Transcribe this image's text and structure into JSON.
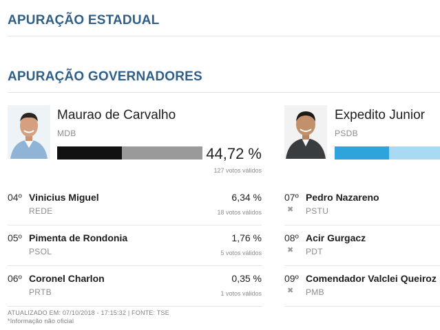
{
  "sections": {
    "state": "APURAÇÃO ESTADUAL",
    "governors": "APURAÇÃO GOVERNADORES"
  },
  "leaders": [
    {
      "name": "Maurao de Carvalho",
      "party": "MDB",
      "percent": "44,72 %",
      "votes": "127 votos válidos",
      "bar_fraction": 0.4472,
      "bar_color": "#111111",
      "bar_rest_color": "#9a9a9a"
    },
    {
      "name": "Expedito Junior",
      "party": "PSDB",
      "bar_color": "#2ea3dc",
      "bar_rest_color": "#a8dbf3"
    }
  ],
  "left_list": [
    {
      "rank": "04º",
      "name": "Vinicius Miguel",
      "party": "REDE",
      "percent": "6,34 %",
      "votes": "18 votos válidos"
    },
    {
      "rank": "05º",
      "name": "Pimenta de Rondonia",
      "party": "PSOL",
      "percent": "1,76 %",
      "votes": "5 votos válidos"
    },
    {
      "rank": "06º",
      "name": "Coronel Charlon",
      "party": "PRTB",
      "percent": "0,35 %",
      "votes": "1 votos válidos"
    }
  ],
  "right_list": [
    {
      "rank": "07º",
      "name": "Pedro Nazareno",
      "party": "PSTU",
      "icon": "x-icon"
    },
    {
      "rank": "08º",
      "name": "Acir Gurgacz",
      "party": "PDT",
      "icon": "x-icon"
    },
    {
      "rank": "09º",
      "name": "Comendador Valclei Queiroz",
      "party": "PMB",
      "icon": "x-icon"
    }
  ],
  "footer": {
    "updated": "ATUALIZADO EM: 07/10/2018 - 17:15:32 | FONTE: TSE",
    "note": "*Informação não oficial"
  }
}
